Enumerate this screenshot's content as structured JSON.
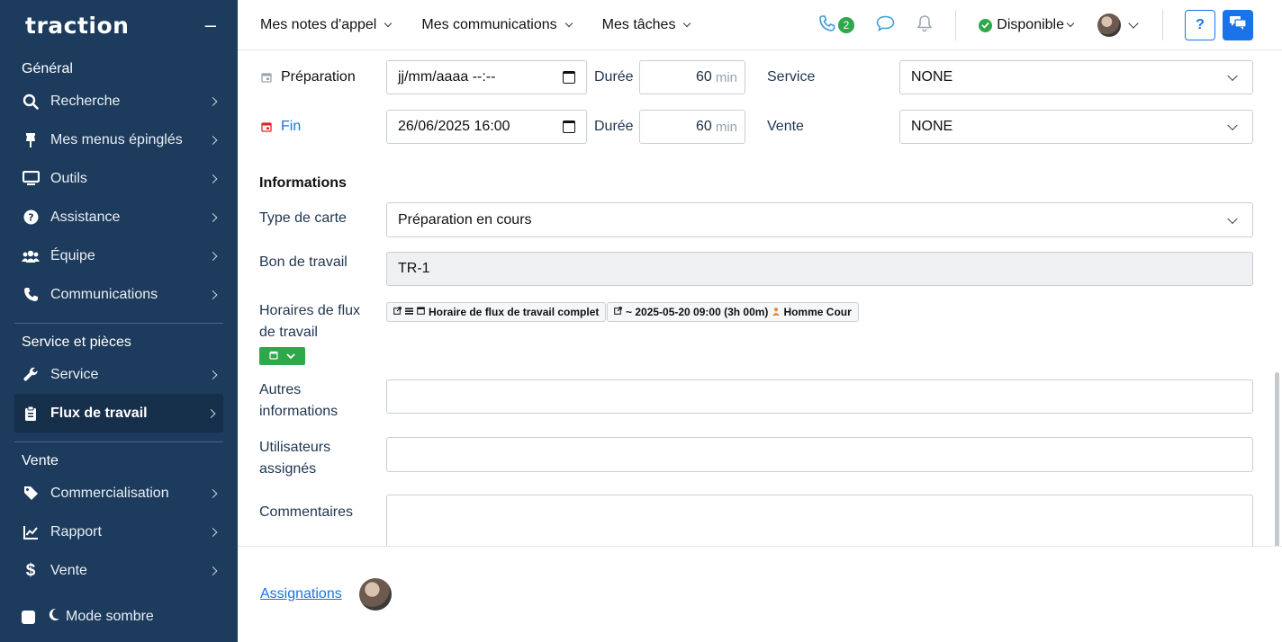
{
  "sidebar": {
    "logo": "traction",
    "collapse": "–",
    "sections": [
      {
        "title": "Général"
      },
      {
        "title": "Service et pièces"
      },
      {
        "title": "Vente"
      }
    ],
    "items": [
      {
        "label": "Recherche",
        "icon": "search-icon"
      },
      {
        "label": "Mes menus épinglés",
        "icon": "pin-icon"
      },
      {
        "label": "Outils",
        "icon": "monitor-icon"
      },
      {
        "label": "Assistance",
        "icon": "question-circle-icon"
      },
      {
        "label": "Équipe",
        "icon": "users-icon"
      },
      {
        "label": "Communications",
        "icon": "phone-icon"
      },
      {
        "label": "Service",
        "icon": "wrench-icon"
      },
      {
        "label": "Flux de travail",
        "icon": "clipboard-icon"
      },
      {
        "label": "Commercialisation",
        "icon": "tag-icon"
      },
      {
        "label": "Rapport",
        "icon": "chart-line-icon"
      },
      {
        "label": "Vente",
        "icon": "dollar-icon"
      }
    ],
    "dark_mode": "Mode sombre"
  },
  "topbar": {
    "menus": [
      "Mes notes d'appel",
      "Mes communications",
      "Mes tâches"
    ],
    "call_count": "2",
    "status": "Disponible",
    "help": "?"
  },
  "form": {
    "preparation": {
      "label": "Préparation",
      "date_value": "jj/mm/aaaa --:--",
      "duration_label": "Durée",
      "duration": "60",
      "unit": "min",
      "side_label": "Service",
      "side_value": "NONE"
    },
    "fin": {
      "label": "Fin",
      "date_value": "26/06/2025 16:00",
      "duration_label": "Durée",
      "duration": "60",
      "unit": "min",
      "side_label": "Vente",
      "side_value": "NONE"
    },
    "section_title": "Informations",
    "type_carte": {
      "label": "Type de carte",
      "value": "Préparation en cours"
    },
    "bon_travail": {
      "label": "Bon de travail",
      "value": "TR-1"
    },
    "horaires": {
      "label_line1": "Horaires de flux",
      "label_line2": "de travail",
      "tag1": "Horaire de flux de travail complet",
      "tag2": "~ 2025-05-20 09:00 (3h 00m)",
      "tag2_person": "Homme Cour"
    },
    "autres": {
      "label_line1": "Autres",
      "label_line2": "informations",
      "value": ""
    },
    "utilisateurs": {
      "label_line1": "Utilisateurs",
      "label_line2": "assignés",
      "value": ""
    },
    "commentaires": {
      "label": "Commentaires",
      "value": ""
    }
  },
  "bottom": {
    "assignations": "Assignations"
  },
  "colors": {
    "sidebar": "#1d3b5c",
    "accent": "#1a73e8",
    "success": "#2ea84a",
    "danger": "#e02424"
  }
}
